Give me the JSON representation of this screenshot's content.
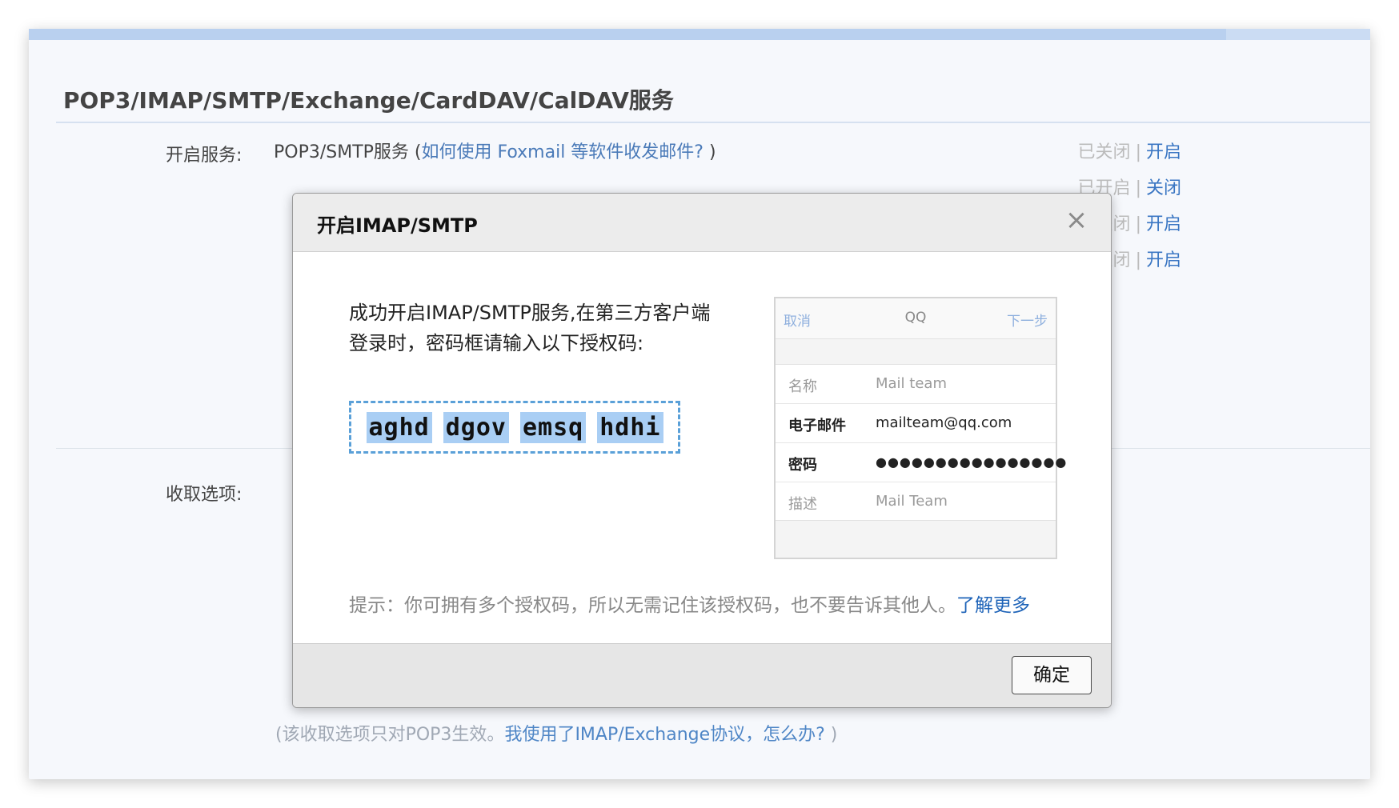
{
  "section": {
    "title": "POP3/IMAP/SMTP/Exchange/CardDAV/CalDAV服务"
  },
  "services": {
    "label": "开启服务:",
    "pop3_text": "POP3/SMTP服务 (",
    "pop3_link": "如何使用 Foxmail 等软件收发邮件?",
    "pop3_close_paren": " )",
    "rows": [
      {
        "status": "已关闭",
        "action": "开启"
      },
      {
        "status": "已开启",
        "action": "关闭"
      },
      {
        "status": "已关闭",
        "action": "开启"
      },
      {
        "status": "已关闭",
        "action": "开启"
      }
    ],
    "separator": "|"
  },
  "receive": {
    "label": "收取选项:",
    "note_prefix": "(该收取选项只对POP3生效。",
    "note_link": "我使用了IMAP/Exchange协议，怎么办?",
    "note_suffix": " )"
  },
  "modal": {
    "title": "开启IMAP/SMTP",
    "close_glyph": "×",
    "intro_line1": "成功开启IMAP/SMTP服务,在第三方客户端",
    "intro_line2": "登录时，密码框请输入以下授权码:",
    "auth_code": [
      "aghd",
      "dgov",
      "emsq",
      "hdhi"
    ],
    "hint_text": "提示：你可拥有多个授权码，所以无需记住该授权码，也不要告诉其他人。",
    "hint_link": "了解更多",
    "ok_label": "确定"
  },
  "phone": {
    "cancel": "取消",
    "title": "QQ",
    "next": "下一步",
    "rows": [
      {
        "key": "名称",
        "value": "Mail team"
      },
      {
        "key": "电子邮件",
        "value": "mailteam@qq.com"
      },
      {
        "key": "密码",
        "value": "●●●●●●●●●●●●●●●●"
      },
      {
        "key": "描述",
        "value": "Mail Team"
      }
    ]
  },
  "colors": {
    "link": "#4a7ab8",
    "accent_bar": "#b9d0ef",
    "code_highlight": "#a9cef4",
    "code_border": "#5aa0d8"
  }
}
